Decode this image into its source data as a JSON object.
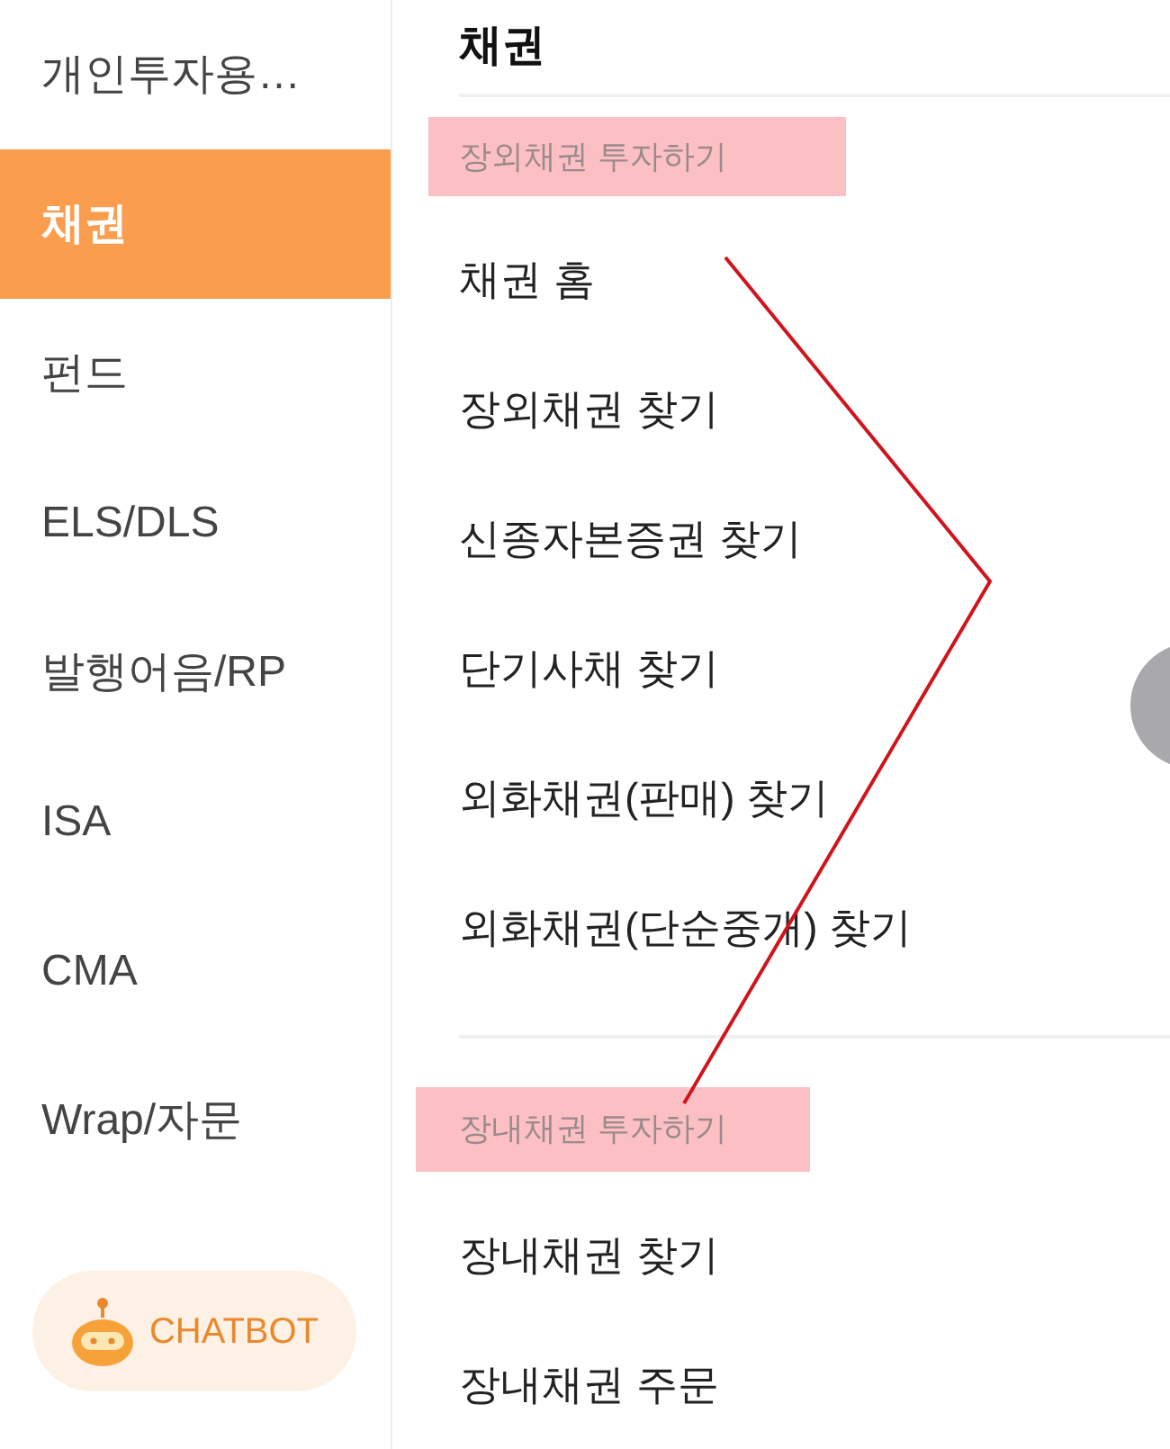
{
  "sidebar": {
    "items": [
      {
        "label": "개인투자용…",
        "selected": false
      },
      {
        "label": "채권",
        "selected": true
      },
      {
        "label": "펀드",
        "selected": false
      },
      {
        "label": "ELS/DLS",
        "selected": false
      },
      {
        "label": "발행어음/RP",
        "selected": false
      },
      {
        "label": "ISA",
        "selected": false
      },
      {
        "label": "CMA",
        "selected": false
      },
      {
        "label": "Wrap/자문",
        "selected": false
      }
    ],
    "chatbot": {
      "label": "CHATBOT"
    }
  },
  "content": {
    "title": "채권",
    "sections": [
      {
        "heading": "장외채권 투자하기",
        "highlighted": true,
        "items": [
          "채권 홈",
          "장외채권 찾기",
          "신종자본증권 찾기",
          "단기사채 찾기",
          "외화채권(판매) 찾기",
          "외화채권(단순중개) 찾기"
        ]
      },
      {
        "heading": "장내채권 투자하기",
        "highlighted": true,
        "items": [
          "장내채권 찾기",
          "장내채권 주문"
        ]
      }
    ]
  }
}
